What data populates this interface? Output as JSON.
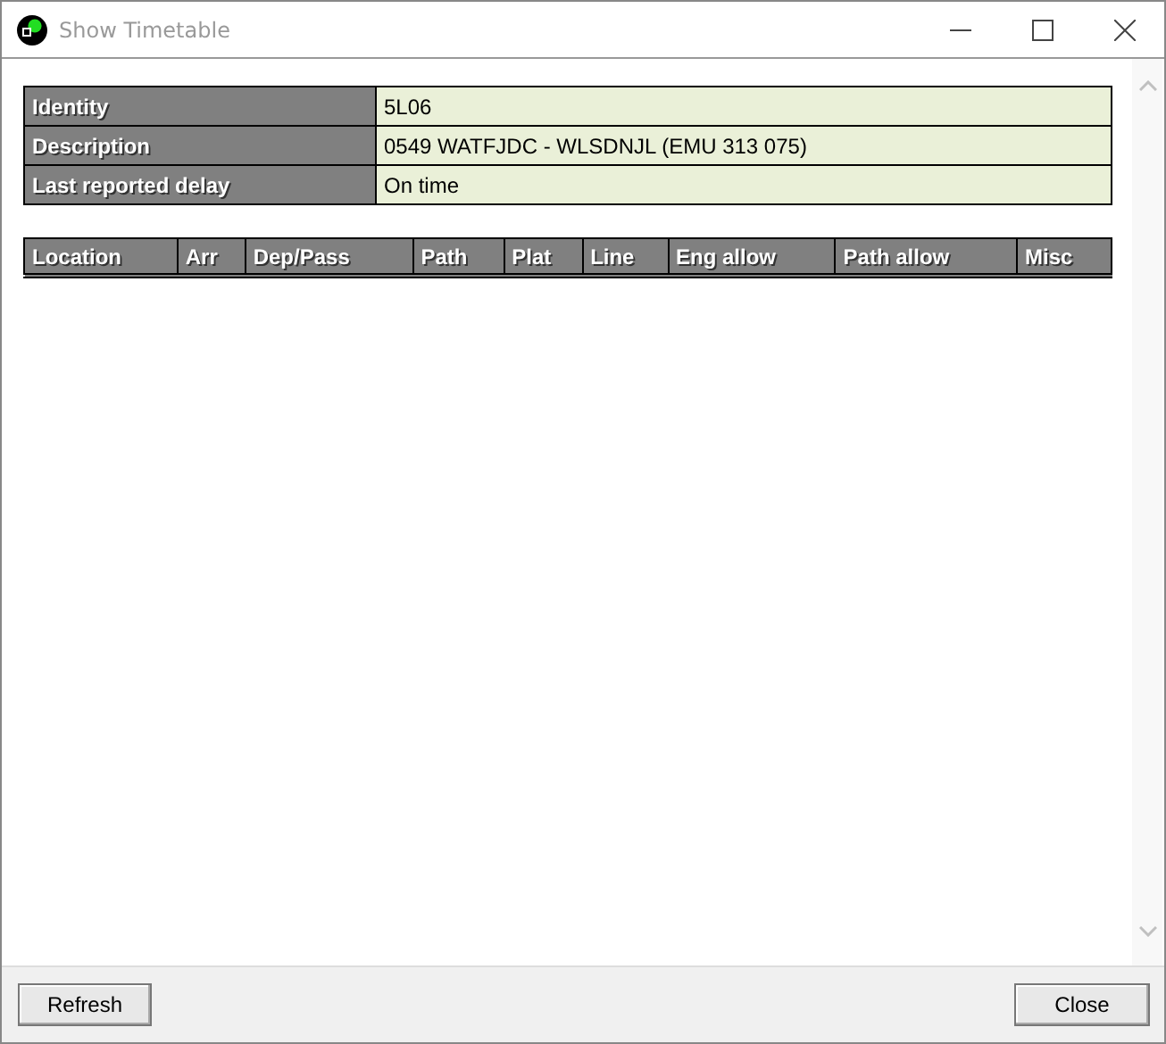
{
  "window": {
    "title": "Show Timetable"
  },
  "details": [
    {
      "label": "Identity",
      "value": "5L06"
    },
    {
      "label": "Description",
      "value": "0549 WATFJDC - WLSDNJL (EMU 313 075)"
    },
    {
      "label": "Last reported delay",
      "value": "On time"
    }
  ],
  "timetable": {
    "columns": [
      "Location",
      "Arr",
      "Dep/Pass",
      "Path",
      "Plat",
      "Line",
      "Eng allow",
      "Path allow",
      "Misc"
    ]
  },
  "buttons": [
    {
      "label": "Refresh"
    },
    {
      "label": "Close"
    }
  ]
}
